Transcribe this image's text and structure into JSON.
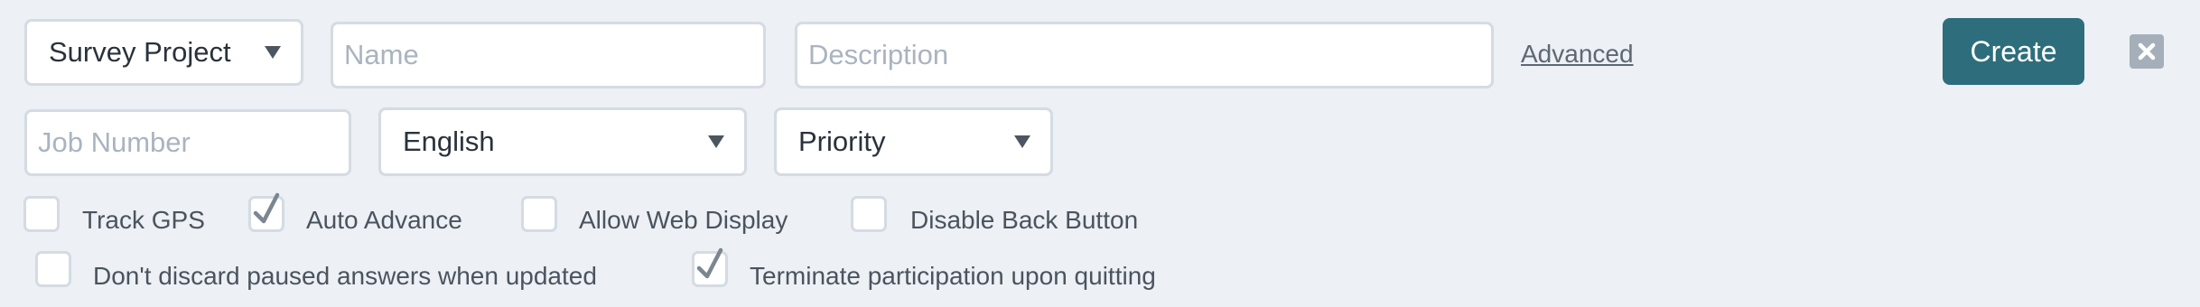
{
  "top_row": {
    "project_type": "Survey Project",
    "name_placeholder": "Name",
    "name_value": "",
    "description_placeholder": "Description",
    "description_value": "",
    "advanced_link": "Advanced",
    "create_button": "Create",
    "close_icon": "close-x-icon"
  },
  "second_row": {
    "job_number_placeholder": "Job Number",
    "job_number_value": "",
    "language": "English",
    "priority": "Priority"
  },
  "options": [
    {
      "label": "Track GPS",
      "checked": false
    },
    {
      "label": "Auto Advance",
      "checked": true
    },
    {
      "label": "Allow Web Display",
      "checked": false
    },
    {
      "label": "Disable Back Button",
      "checked": false
    },
    {
      "label": "Don't discard paused answers when updated",
      "checked": false
    },
    {
      "label": "Terminate participation upon quitting",
      "checked": true
    }
  ],
  "colors": {
    "background": "#edf0f4",
    "primary_button": "#2e6e7c",
    "field_border": "#d4dbe3",
    "placeholder": "#a9b4c0"
  }
}
